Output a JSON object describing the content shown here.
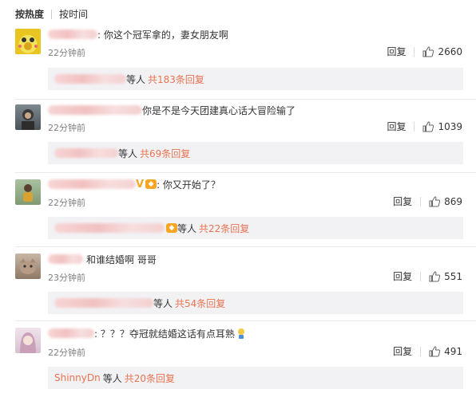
{
  "sort": {
    "hot": "按热度",
    "time": "按时间"
  },
  "actions": {
    "reply": "回复"
  },
  "comments": [
    {
      "text": ": 你这个冠军拿的，妻女朋友啊",
      "time": "22分钟前",
      "likes": "2660",
      "reply_deng": "等人",
      "reply_more": "共183条回复"
    },
    {
      "text": "你是不是今天团建真心话大冒险输了",
      "time": "22分钟前",
      "likes": "1039",
      "reply_deng": "等人",
      "reply_more": "共69条回复"
    },
    {
      "text": ": 你又开始了？",
      "time": "22分钟前",
      "likes": "869",
      "reply_deng": "等人",
      "reply_more": "共22条回复"
    },
    {
      "text": "和谁结婚啊 哥哥",
      "time": "23分钟前",
      "likes": "551",
      "reply_deng": "等人",
      "reply_more": "共54条回复"
    },
    {
      "text": ": ？？？夺冠就结婚这话有点耳熟",
      "time": "22分钟前",
      "likes": "491",
      "reply_name": "ShinnyDn",
      "reply_deng": "等人",
      "reply_more": "共20条回复"
    }
  ],
  "colors": {
    "accent": "#eb7350",
    "reply_bg": "#f2f2f5",
    "badge": "#f5a623"
  }
}
